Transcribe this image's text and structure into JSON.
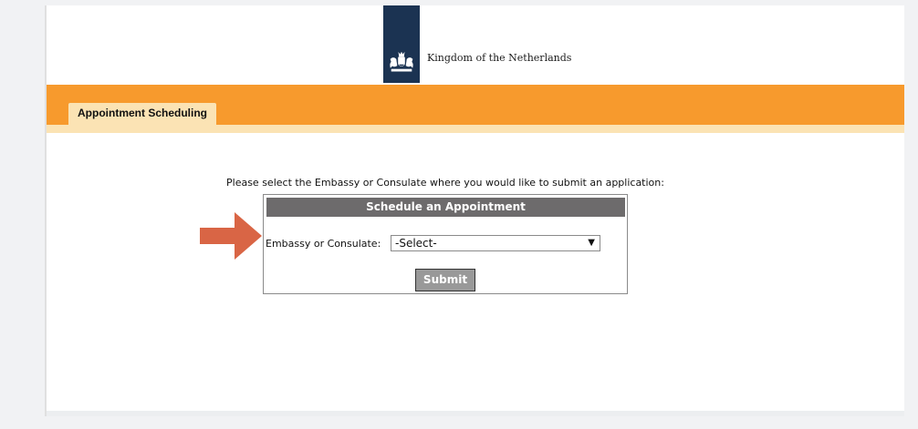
{
  "header": {
    "brand_text": "Kingdom of the Netherlands"
  },
  "nav": {
    "tabs": [
      {
        "label": "Appointment Scheduling"
      }
    ]
  },
  "main": {
    "instruction": "Please select the Embassy or Consulate where you would like to submit an application:",
    "form": {
      "title": "Schedule an Appointment",
      "field_label": "Embassy or Consulate:",
      "select_value": "-Select-",
      "submit_label": "Submit"
    }
  },
  "icons": {
    "crest": "royal-crest-icon",
    "dropdown": "chevron-down-icon",
    "annotation": "arrow-right-icon"
  },
  "colors": {
    "brand_blue": "#1b3352",
    "orange": "#f79a2d",
    "cream": "#fbe3b4",
    "header_gray": "#6d6b6c",
    "button_gray": "#999999",
    "arrow": "#d96545"
  }
}
